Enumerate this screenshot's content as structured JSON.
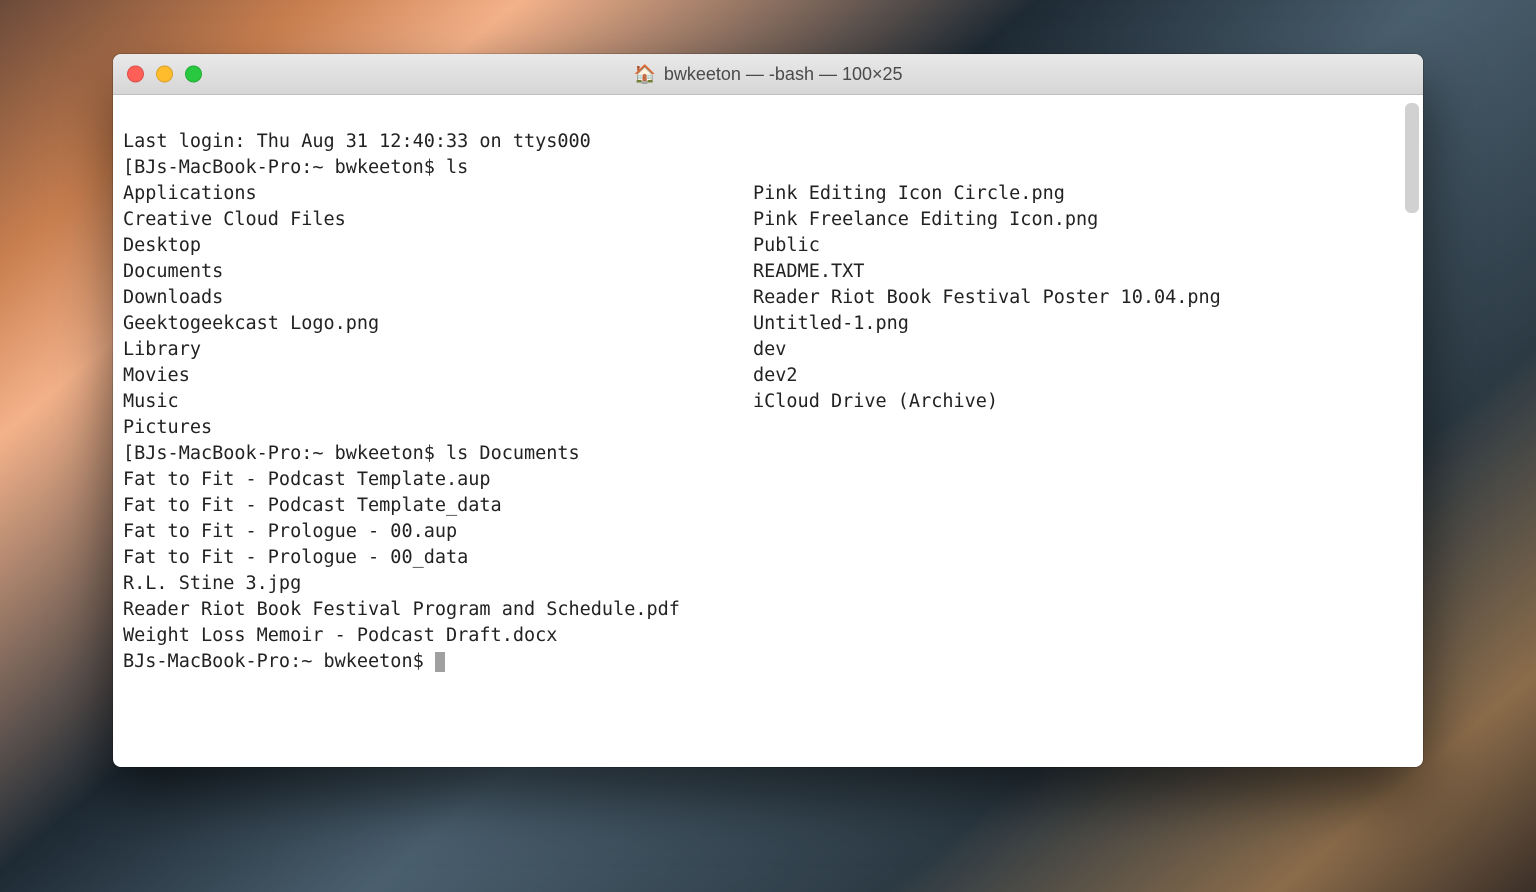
{
  "window": {
    "title": "bwkeeton — -bash — 100×25",
    "home_icon": "🏠"
  },
  "terminal": {
    "last_login": "Last login: Thu Aug 31 12:40:33 on ttys000",
    "prompt1_prefix_bracket": "[",
    "prompt1": "BJs-MacBook-Pro:~ bwkeeton$ ",
    "cmd1": "ls",
    "ls_home_col1": [
      "Applications",
      "Creative Cloud Files",
      "Desktop",
      "Documents",
      "Downloads",
      "Geektogeekcast Logo.png",
      "Library",
      "Movies",
      "Music",
      "Pictures"
    ],
    "ls_home_col2": [
      "Pink Editing Icon Circle.png",
      "Pink Freelance Editing Icon.png",
      "Public",
      "README.TXT",
      "Reader Riot Book Festival Poster 10.04.png",
      "Untitled-1.png",
      "dev",
      "dev2",
      "iCloud Drive (Archive)",
      ""
    ],
    "prompt2_prefix_bracket": "[",
    "prompt2": "BJs-MacBook-Pro:~ bwkeeton$ ",
    "cmd2": "ls Documents",
    "ls_docs": [
      "Fat to Fit - Podcast Template.aup",
      "Fat to Fit - Podcast Template_data",
      "Fat to Fit - Prologue - 00.aup",
      "Fat to Fit - Prologue - 00_data",
      "R.L. Stine 3.jpg",
      "Reader Riot Book Festival Program and Schedule.pdf",
      "Weight Loss Memoir - Podcast Draft.docx"
    ],
    "prompt3": "BJs-MacBook-Pro:~ bwkeeton$ "
  }
}
